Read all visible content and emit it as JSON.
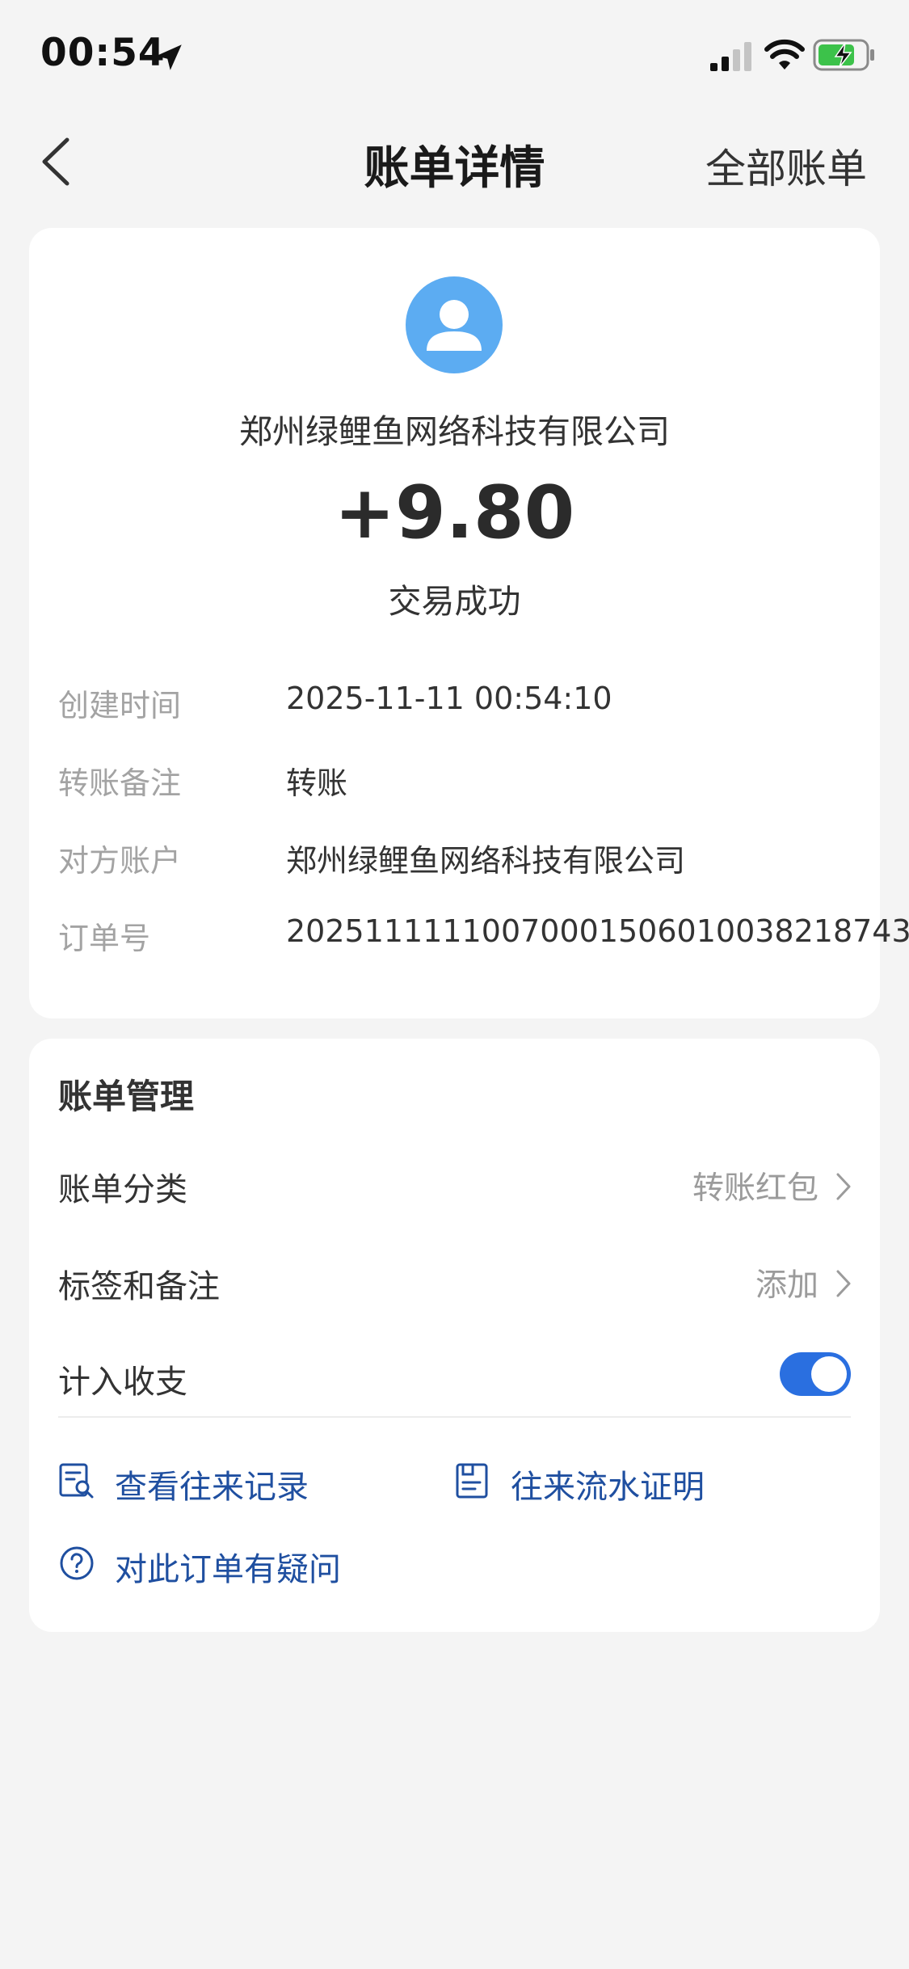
{
  "status_bar": {
    "time": "00:54"
  },
  "nav": {
    "title": "账单详情",
    "right_link": "全部账单"
  },
  "summary": {
    "payee": "郑州绿鲤鱼网络科技有限公司",
    "amount": "+9.80",
    "status": "交易成功"
  },
  "details": [
    {
      "label": "创建时间",
      "value": "2025-11-11 00:54:10"
    },
    {
      "label": "转账备注",
      "value": "转账"
    },
    {
      "label": "对方账户",
      "value": "郑州绿鲤鱼网络科技有限公司"
    },
    {
      "label": "订单号",
      "value": "2025111111007000150601003821874​3"
    }
  ],
  "manage": {
    "title": "账单管理",
    "category_label": "账单分类",
    "category_value": "转账红包",
    "tags_label": "标签和备注",
    "tags_value": "添加",
    "include_label": "计入收支",
    "include_enabled": true,
    "links": {
      "records": "查看往来记录",
      "proof": "往来流水证明",
      "question": "对此订单有疑问"
    }
  },
  "colors": {
    "background": "#f4f4f4",
    "card": "#ffffff",
    "accent": "#2a6fe0",
    "link": "#1f4fa0",
    "avatar": "#5cacf2",
    "battery_charging": "#3cc24a"
  }
}
